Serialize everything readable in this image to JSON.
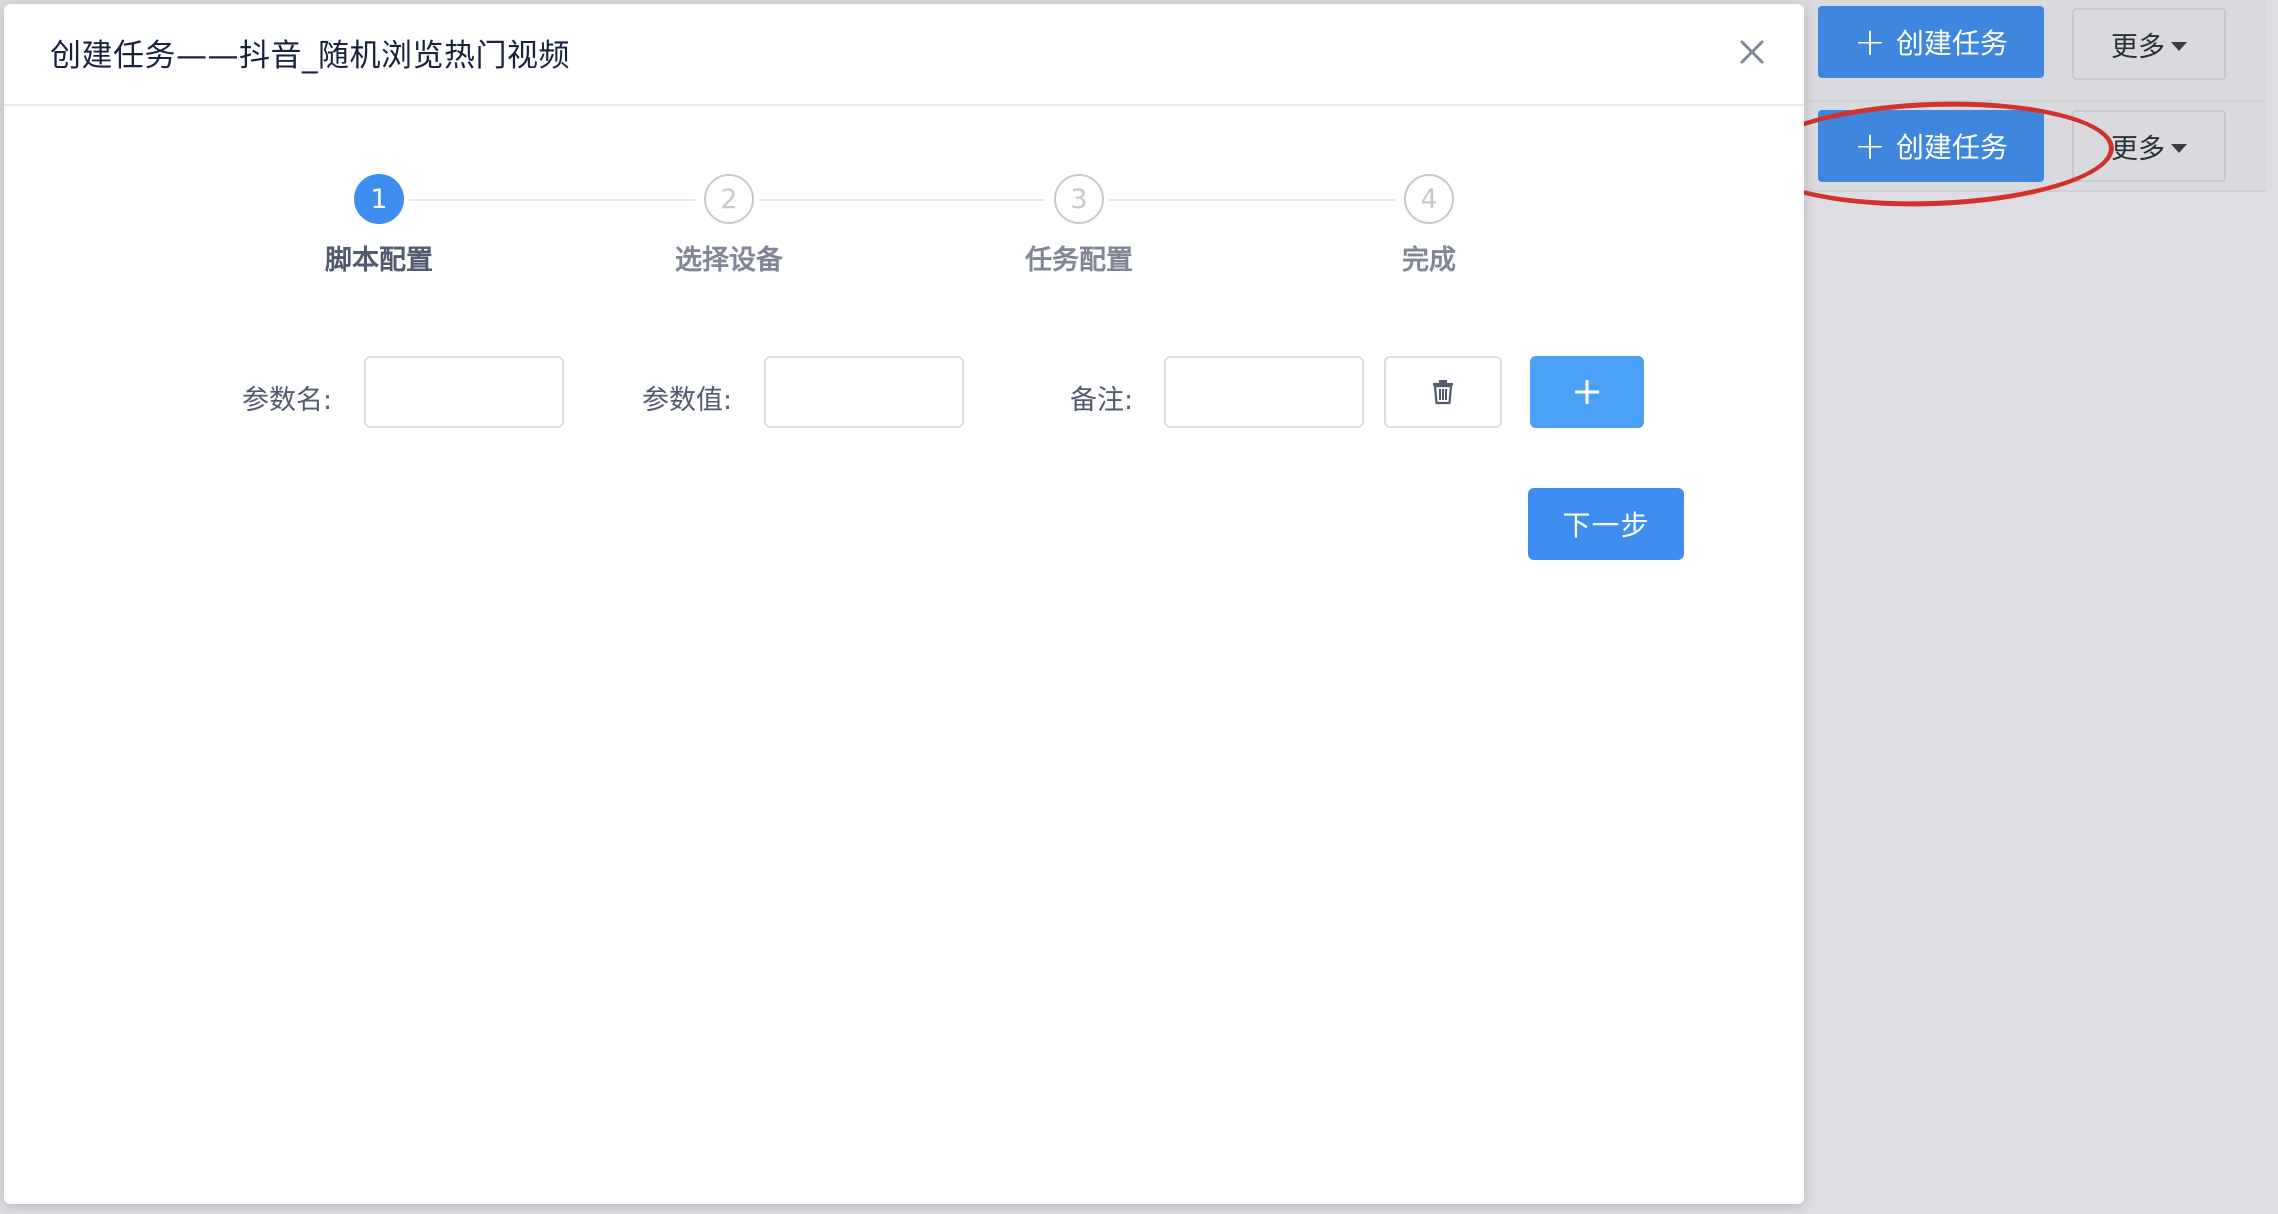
{
  "modal": {
    "title": "创建任务——抖音_随机浏览热门视频",
    "close_icon": "close-icon"
  },
  "steps": [
    {
      "number": "1",
      "label": "脚本配置",
      "state": "active"
    },
    {
      "number": "2",
      "label": "选择设备",
      "state": "todo"
    },
    {
      "number": "3",
      "label": "任务配置",
      "state": "todo"
    },
    {
      "number": "4",
      "label": "完成",
      "state": "todo"
    }
  ],
  "params": {
    "name_label": "参数名:",
    "name_value": "",
    "value_label": "参数值:",
    "value_value": "",
    "note_label": "备注:",
    "note_value": "",
    "delete_icon": "trash-icon",
    "add_icon": "plus-icon"
  },
  "next_button": "下一步",
  "background_toolbar": {
    "create_task_label": "创建任务",
    "more_label": "更多"
  },
  "colors": {
    "primary": "#3d8ef0",
    "annotation": "#d2322d"
  }
}
